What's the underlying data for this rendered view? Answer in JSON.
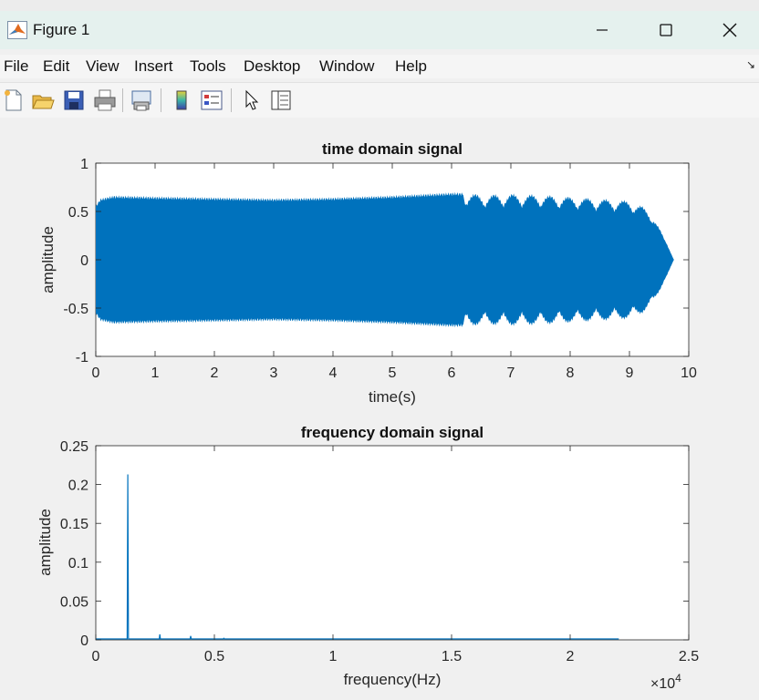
{
  "window": {
    "title": "Figure 1",
    "minimize_label": "—",
    "maximize_label": "☐",
    "close_label": "✕"
  },
  "menu": [
    "File",
    "Edit",
    "View",
    "Insert",
    "Tools",
    "Desktop",
    "Window",
    "Help"
  ],
  "toolbar_icons": [
    "new-figure-icon",
    "open-file-icon",
    "save-icon",
    "print-icon",
    "print-preview-icon",
    "colorbar-icon",
    "legend-icon",
    "pointer-icon",
    "property-inspector-icon"
  ],
  "colors": {
    "line": "#0072BD",
    "axes_bg": "#ffffff",
    "figure_bg": "#f0f0f0"
  },
  "chart_data": [
    {
      "type": "line",
      "title": "time domain signal",
      "xlabel": "time(s)",
      "ylabel": "amplitude",
      "xlim": [
        0,
        10
      ],
      "ylim": [
        -1,
        1
      ],
      "xticks": [
        "0",
        "1",
        "2",
        "3",
        "4",
        "5",
        "6",
        "7",
        "8",
        "9",
        "10"
      ],
      "yticks": [
        "1",
        "0.5",
        "0",
        "-0.5",
        "-1"
      ],
      "grid": false,
      "envelope": {
        "t": [
          0.0,
          0.08,
          0.3,
          1,
          2,
          3,
          4,
          5,
          6,
          6.3,
          6.5,
          7,
          7.5,
          8,
          8.5,
          9,
          9.2,
          9.4,
          9.6,
          9.75
        ],
        "amp": [
          0.55,
          0.62,
          0.65,
          0.64,
          0.63,
          0.62,
          0.63,
          0.65,
          0.68,
          0.68,
          0.66,
          0.67,
          0.66,
          0.64,
          0.62,
          0.6,
          0.55,
          0.45,
          0.2,
          0.0
        ]
      }
    },
    {
      "type": "line",
      "title": "frequency domain signal",
      "xlabel": "frequency(Hz)",
      "ylabel": "amplitude",
      "xlim": [
        0,
        25000
      ],
      "ylim": [
        0,
        0.25
      ],
      "xticks": [
        "0",
        "0.5",
        "1",
        "1.5",
        "2",
        "2.5"
      ],
      "yticks": [
        "0.25",
        "0.2",
        "0.15",
        "0.1",
        "0.05",
        "0"
      ],
      "x_multiplier": "×10",
      "x_multiplier_exponent": "4",
      "grid": false,
      "x_max_data": 22050,
      "peaks": [
        {
          "f": 1350,
          "a": 0.213
        },
        {
          "f": 2700,
          "a": 0.007
        },
        {
          "f": 4000,
          "a": 0.005
        },
        {
          "f": 5400,
          "a": 0.002
        }
      ]
    }
  ]
}
